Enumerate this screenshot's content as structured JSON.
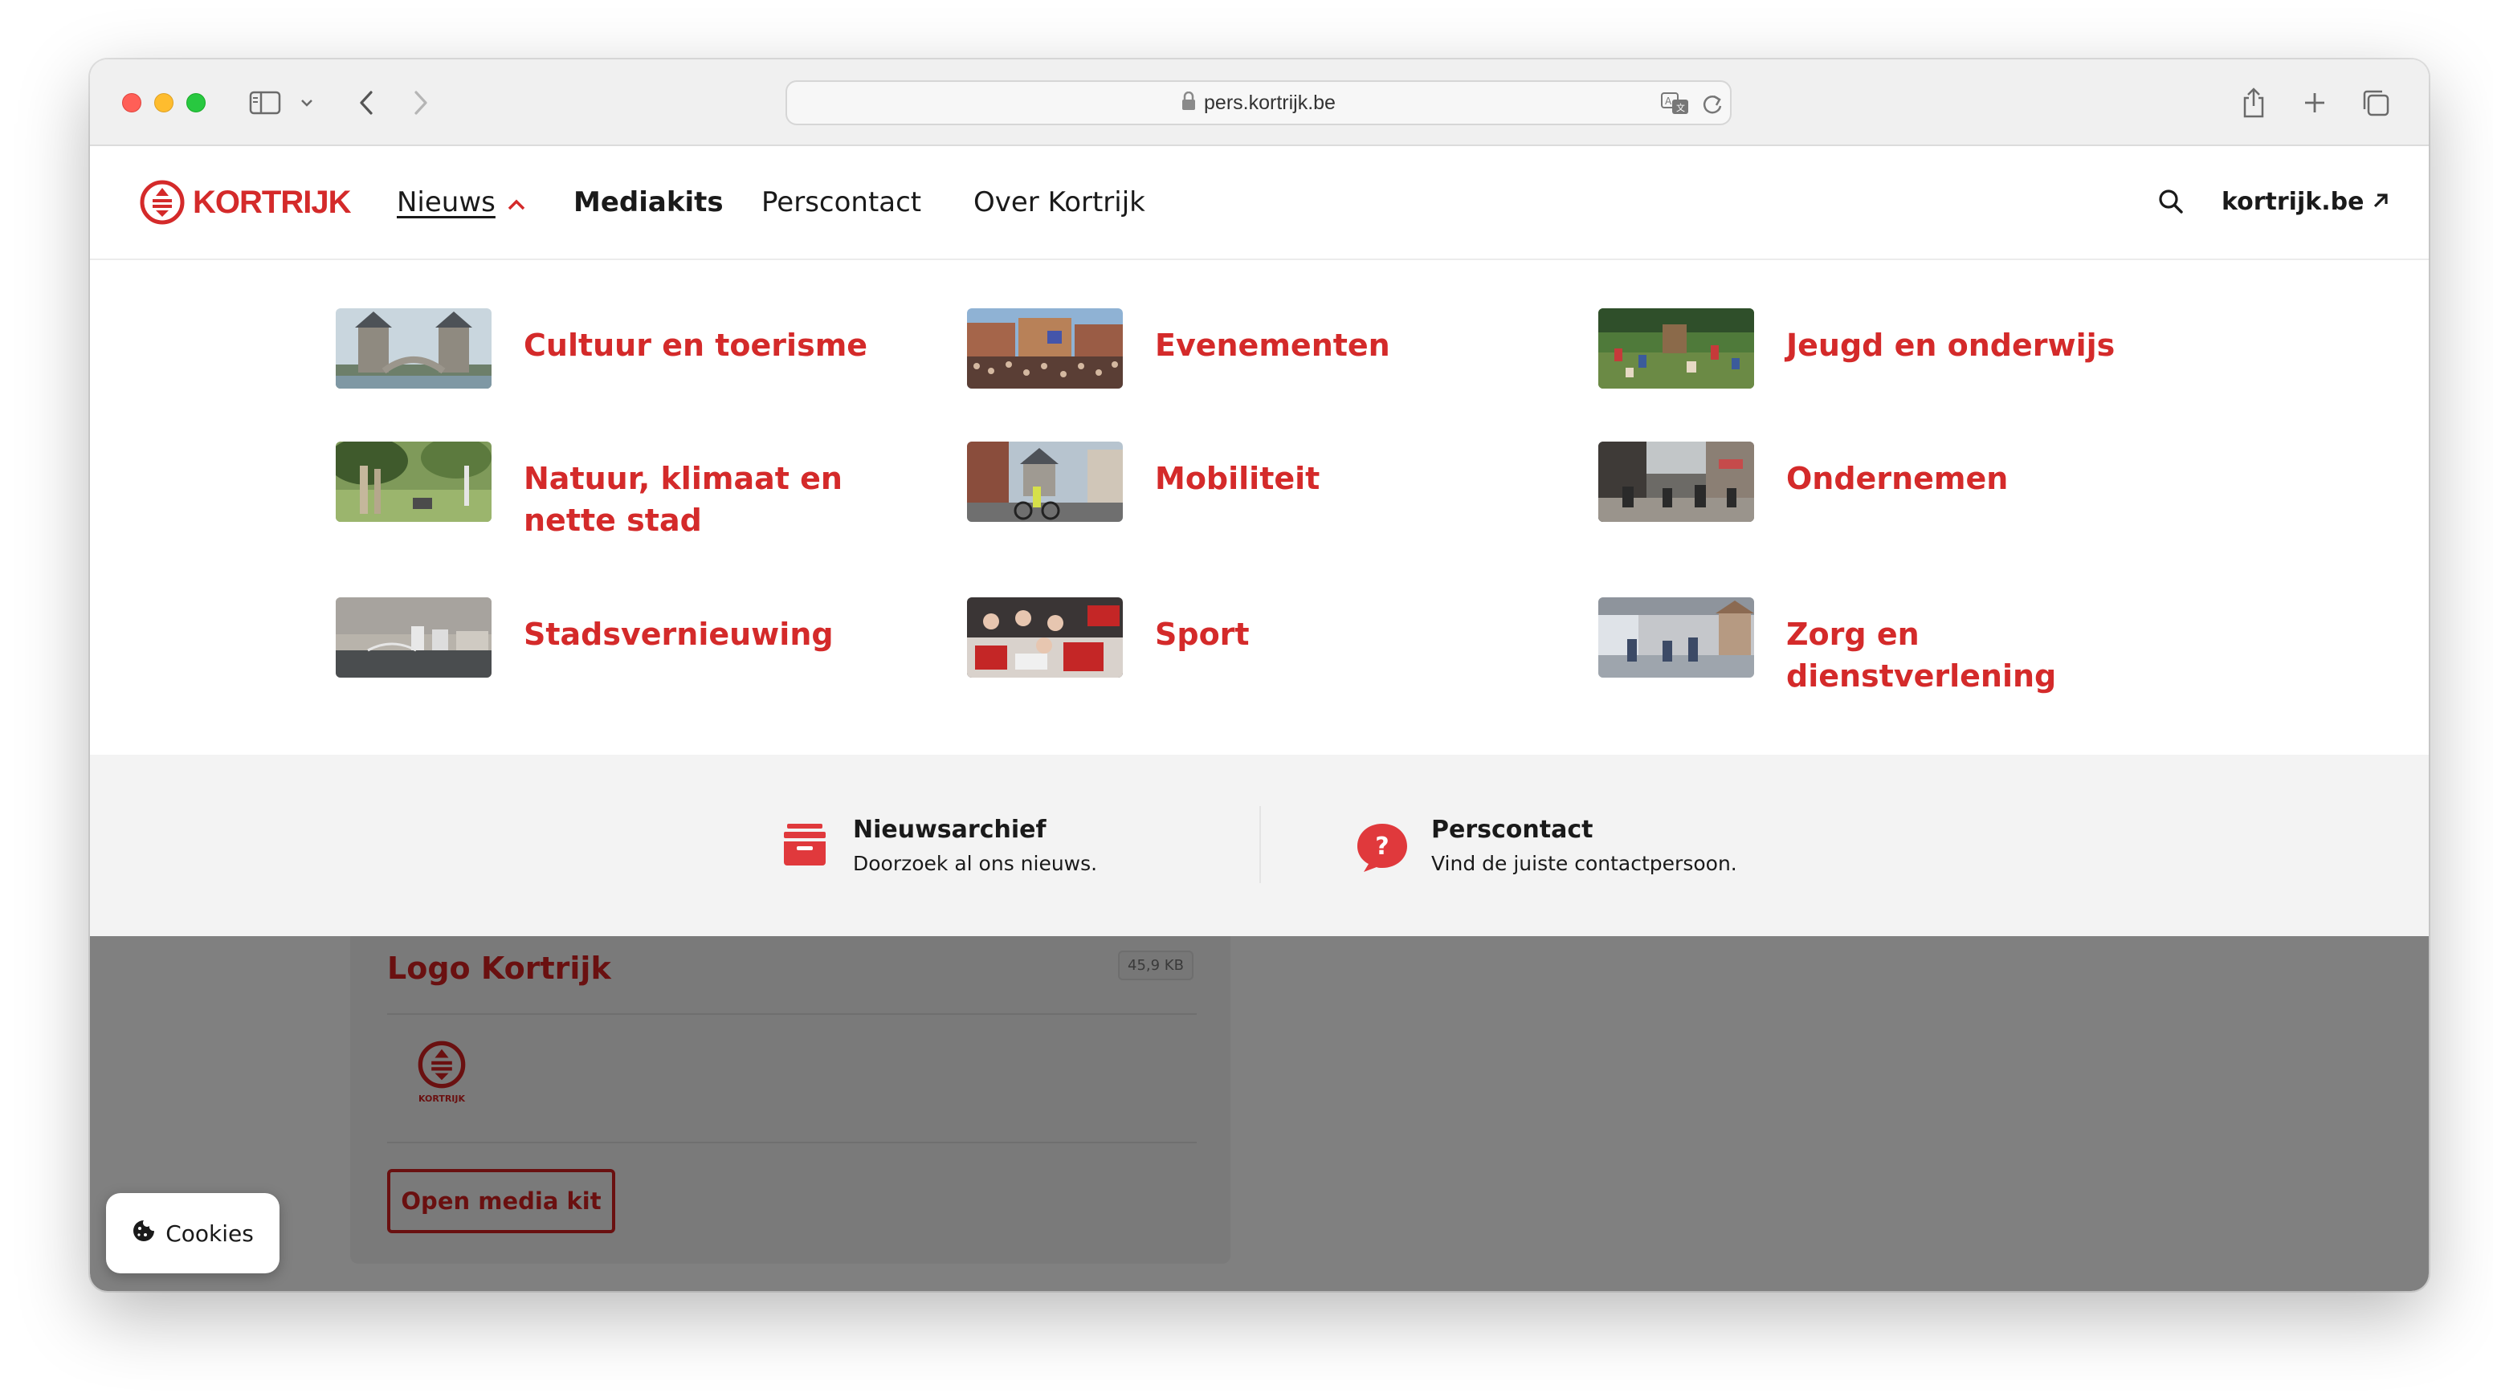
{
  "browser": {
    "url": "pers.kortrijk.be",
    "icons": [
      "sidebar-icon",
      "chevron-down-icon",
      "back-icon",
      "forward-icon",
      "lock-icon",
      "translate-icon",
      "reload-icon",
      "share-icon",
      "new-tab-icon",
      "tabs-overview-icon"
    ]
  },
  "site": {
    "logo_text": "KORTRIJK",
    "nav": {
      "nieuws": "Nieuws",
      "mediakits": "Mediakits",
      "perscontact": "Perscontact",
      "over": "Over Kortrijk"
    },
    "external_link": "kortrijk.be",
    "accent_color": "#d42a2a"
  },
  "mega_menu": {
    "categories": [
      {
        "label": "Cultuur en toerisme"
      },
      {
        "label": "Evenementen"
      },
      {
        "label": "Jeugd en onderwijs"
      },
      {
        "label": "Natuur, klimaat en nette stad"
      },
      {
        "label": "Mobiliteit"
      },
      {
        "label": "Ondernemen"
      },
      {
        "label": "Stadsvernieuwing"
      },
      {
        "label": "Sport"
      },
      {
        "label": "Zorg en dienstverlening"
      }
    ],
    "quick_links": [
      {
        "title": "Nieuwsarchief",
        "subtitle": "Doorzoek al ons nieuws."
      },
      {
        "title": "Perscontact",
        "subtitle": "Vind de juiste contactpersoon."
      }
    ]
  },
  "background_card": {
    "title": "Logo Kortrijk",
    "file_size": "45,9 KB",
    "logo_caption": "KORTRIJK",
    "button": "Open media kit"
  },
  "cookie_button": "Cookies"
}
